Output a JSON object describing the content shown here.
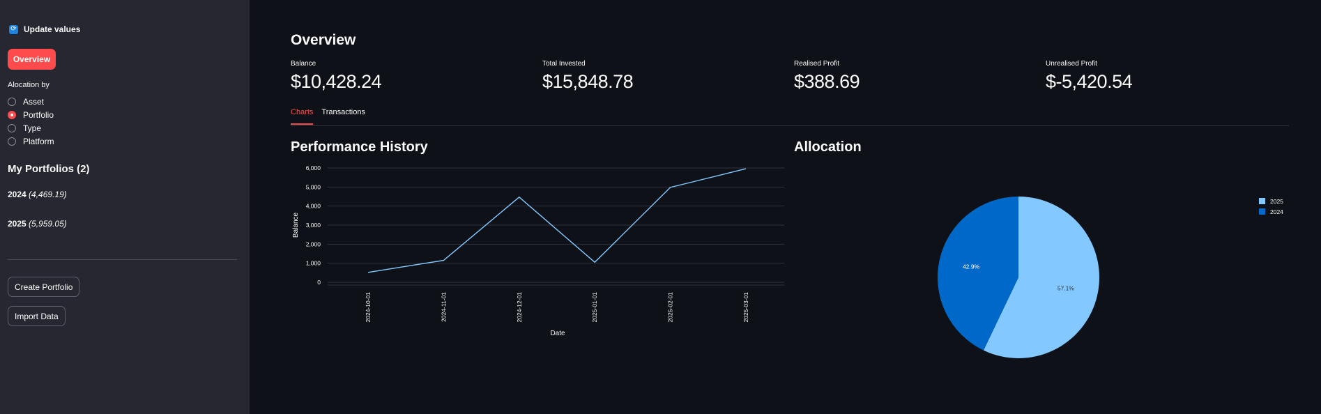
{
  "sidebar": {
    "update_label": "Update values",
    "update_icon": "refresh-icon",
    "overview_button": "Overview",
    "allocation_label": "Alocation by",
    "allocation_options": [
      "Asset",
      "Portfolio",
      "Type",
      "Platform"
    ],
    "allocation_selected": "Portfolio",
    "portfolios_heading": "My Portfolios (2)",
    "portfolios": [
      {
        "name": "2024",
        "value": "(4,469.19)"
      },
      {
        "name": "2025",
        "value": "(5,959.05)"
      }
    ],
    "create_button": "Create Portfolio",
    "import_button": "Import Data"
  },
  "main": {
    "title": "Overview",
    "metrics": [
      {
        "label": "Balance",
        "value": "$10,428.24"
      },
      {
        "label": "Total Invested",
        "value": "$15,848.78"
      },
      {
        "label": "Realised Profit",
        "value": "$388.69"
      },
      {
        "label": "Unrealised Profit",
        "value": "$-5,420.54"
      }
    ],
    "tabs": [
      "Charts",
      "Transactions"
    ],
    "active_tab": "Charts",
    "performance_title": "Performance History",
    "allocation_title": "Allocation"
  },
  "colors": {
    "accent": "#ff4b4b",
    "line": "#83c9ff",
    "pie_2025": "#83c9ff",
    "pie_2024": "#0068c9"
  },
  "chart_data": [
    {
      "type": "line",
      "x": [
        "2024-10-01",
        "2024-11-01",
        "2024-12-01",
        "2025-01-01",
        "2025-02-01",
        "2025-03-01"
      ],
      "series": [
        {
          "values": [
            520,
            1150,
            4470,
            1050,
            4980,
            5960
          ]
        }
      ],
      "xlabel": "Date",
      "ylabel": "Balance",
      "yticks": [
        "0",
        "1,000",
        "2,000",
        "3,000",
        "4,000",
        "5,000",
        "6,000"
      ],
      "ylim": [
        0,
        6000
      ],
      "grid": true
    },
    {
      "type": "pie",
      "labels": [
        "2025",
        "2024"
      ],
      "values": [
        57.1,
        42.9
      ],
      "value_labels": [
        "57.1%",
        "42.9%"
      ],
      "legend": "top-right"
    }
  ]
}
